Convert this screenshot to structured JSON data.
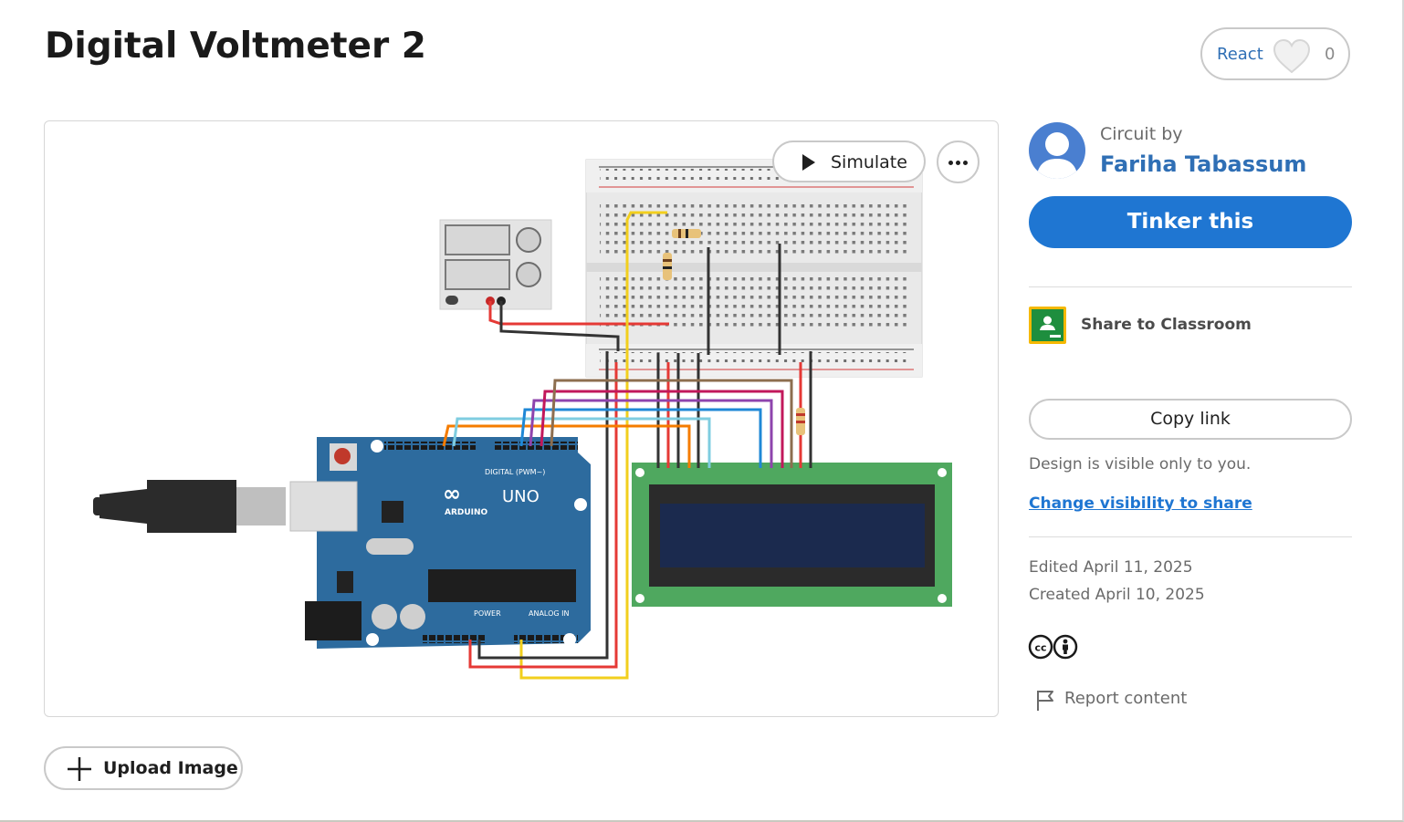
{
  "project": {
    "title": "Digital Voltmeter 2"
  },
  "react": {
    "label": "React",
    "count": "0"
  },
  "canvas": {
    "simulate_label": "Simulate",
    "arduino_brand": "ARDUINO",
    "arduino_model": "UNO",
    "arduino_digital_label": "DIGITAL (PWM~)",
    "arduino_power_label": "POWER",
    "arduino_analog_label": "ANALOG IN"
  },
  "author": {
    "by_label": "Circuit by",
    "name": "Fariha Tabassum"
  },
  "actions": {
    "tinker_label": "Tinker this",
    "classroom_label": "Share to Classroom",
    "copy_link_label": "Copy link",
    "upload_label": "Upload Image",
    "report_label": "Report content"
  },
  "visibility": {
    "status": "Design is visible only to you.",
    "change_link": "Change visibility to share"
  },
  "dates": {
    "edited": "Edited April 11, 2025",
    "created": "Created April 10, 2025"
  },
  "colors": {
    "accent": "#1f76d2",
    "link": "#2f6fb5",
    "arduino": "#2d6b9e",
    "lcd_board": "#4fa85f",
    "lcd_screen": "#1b2a4e"
  }
}
